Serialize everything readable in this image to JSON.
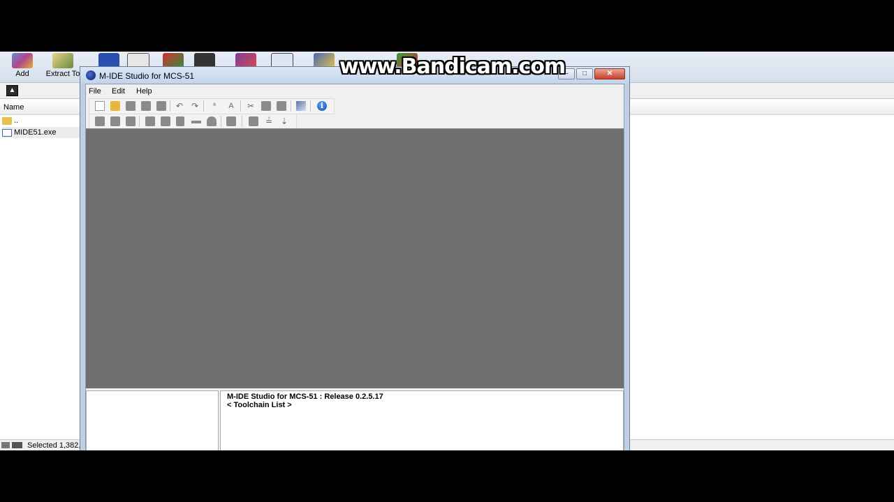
{
  "background_app": {
    "toolbar": [
      {
        "label": "Add",
        "icon": "add-archive-icon"
      },
      {
        "label": "Extract To",
        "icon": "extract-to-icon"
      },
      {
        "label": "",
        "icon": "test-icon"
      },
      {
        "label": "",
        "icon": "view-icon"
      },
      {
        "label": "",
        "icon": "delete-icon"
      },
      {
        "label": "",
        "icon": "find-icon"
      },
      {
        "label": "",
        "icon": "wizard-icon"
      },
      {
        "label": "",
        "icon": "info-icon"
      },
      {
        "label": "",
        "icon": "repair-icon"
      },
      {
        "label": "",
        "icon": "comment-icon"
      }
    ],
    "column_name": "Name",
    "files": [
      {
        "name": "..",
        "icon": "folder-up-icon"
      },
      {
        "name": "MIDE51.exe",
        "icon": "exe-file-icon"
      }
    ],
    "status": "Selected 1,382,"
  },
  "window": {
    "title": "M-IDE Studio for MCS-51",
    "menu": [
      "File",
      "Edit",
      "Help"
    ],
    "output_lines": [
      "M-IDE Studio for MCS-51 : Release 0.2.5.17",
      "< Toolchain List >"
    ]
  },
  "watermark": "www.Bandicam.com",
  "colors": {
    "workspace": "#6f6f6f",
    "titlebar": "#c3d4ea",
    "close_button": "#c7402a"
  }
}
